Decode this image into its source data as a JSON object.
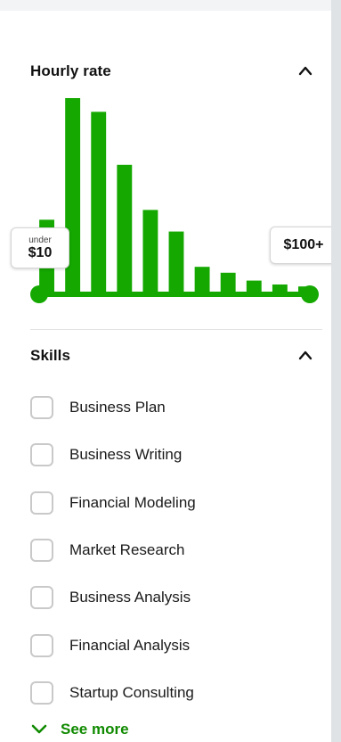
{
  "hourly_rate": {
    "title": "Hourly rate",
    "collapse_icon": "chevron-up-icon",
    "min_label_small": "under",
    "min_label_value": "$10",
    "max_label_value": "$100+",
    "accent_color": "#14a800",
    "histogram_levels": [
      0.38,
      1.0,
      0.93,
      0.66,
      0.43,
      0.32,
      0.14,
      0.11,
      0.07,
      0.05,
      0.04
    ]
  },
  "skills": {
    "title": "Skills",
    "collapse_icon": "chevron-up-icon",
    "items": [
      {
        "label": "Business Plan",
        "checked": false
      },
      {
        "label": "Business Writing",
        "checked": false
      },
      {
        "label": "Financial Modeling",
        "checked": false
      },
      {
        "label": "Market Research",
        "checked": false
      },
      {
        "label": "Business Analysis",
        "checked": false
      },
      {
        "label": "Financial Analysis",
        "checked": false
      },
      {
        "label": "Startup Consulting",
        "checked": false
      }
    ],
    "see_more_label": "See more",
    "see_more_icon": "chevron-down-icon",
    "link_color": "#108a00"
  }
}
